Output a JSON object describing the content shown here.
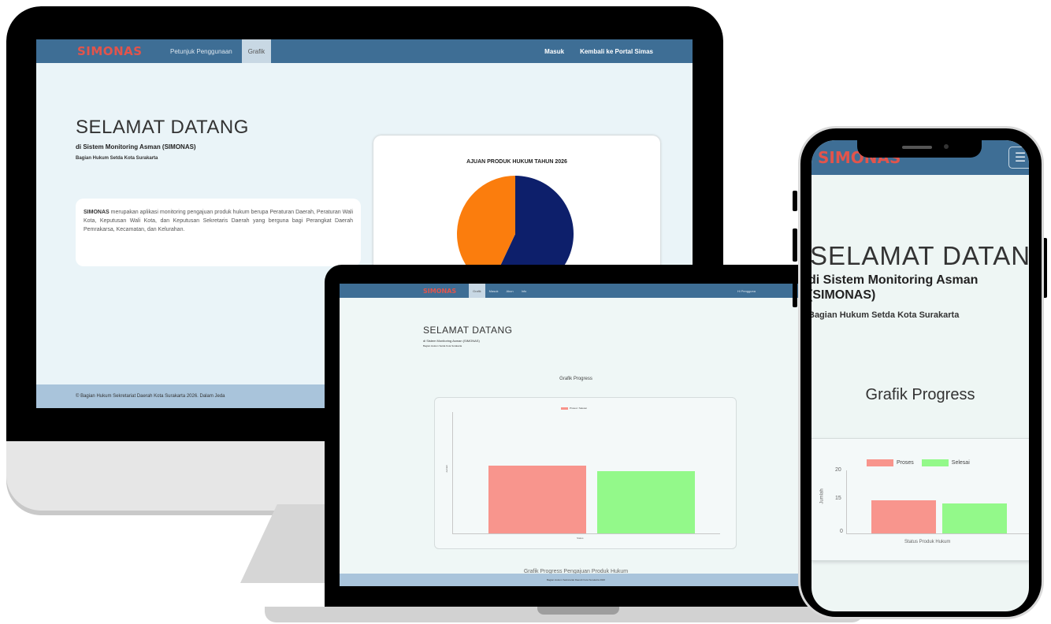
{
  "brand": {
    "logo": "SIMONAS",
    "accent": "#e3544b",
    "nav_bg": "#3e6e95",
    "footer_bg": "#a9c4db"
  },
  "desktop": {
    "nav": {
      "links": [
        "Petunjuk Penggunaan",
        "Grafik"
      ],
      "right_links": [
        "Masuk",
        "Kembali ke Portal Simas"
      ]
    },
    "hero": {
      "title": "SELAMAT DATANG",
      "subtitle": "di Sistem Monitoring Asman (SIMONAS)",
      "org": "Bagian Hukum Setda Kota Surakarta"
    },
    "description": {
      "lead": "SIMONAS",
      "text": " merupakan aplikasi monitoring pengajuan produk hukum berupa Peraturan Daerah, Peraturan Wali Kota, Keputusan Wali Kota, dan Keputusan Sekretaris Daerah yang berguna bagi Perangkat Daerah Pemrakarsa, Kecamatan, dan Kelurahan."
    },
    "chart_title": "AJUAN PRODUK HUKUM TAHUN 2026",
    "footer": "© Bagian Hukum Sekretariat Daerah Kota Surakarta 2026. Dalam Jeda"
  },
  "laptop": {
    "nav": {
      "links": [
        "Grafik",
        "Masuk",
        "Akun",
        "Info"
      ],
      "right": "Hi Pengguna"
    },
    "hero": {
      "title": "SELAMAT DATANG",
      "subtitle": "di Sistem Monitoring Asman (SIMONAS)",
      "org": "Bagian Hukum Setda Kota Surakarta"
    },
    "graf_title": "Grafik Progress",
    "legend": "Proses / Selesai",
    "y_label": "Jumlah",
    "x_label": "Status",
    "footer_title": "Grafik Progress Pengajuan Produk Hukum",
    "footer": "Bagian Hukum Sekretariat Daerah Kota Surakarta 2026"
  },
  "phone": {
    "hero": {
      "title": "SELAMAT DATANG",
      "subtitle": "di Sistem Monitoring Asman (SIMONAS)",
      "org": "Bagian Hukum Setda Kota Surakarta"
    },
    "graf_title": "Grafik Progress",
    "legend": {
      "proses": "Proses",
      "selesai": "Selesai"
    },
    "y_ticks": [
      "20",
      "15",
      "0"
    ],
    "y_label": "Jumlah",
    "x_label": "Status Produk Hukum"
  },
  "chart_data": [
    {
      "type": "pie",
      "title": "AJUAN PRODUK HUKUM TAHUN 2026",
      "categories": [
        "Selesai",
        "Proses"
      ],
      "values": [
        57,
        43
      ],
      "colors": [
        "#0d1f6b",
        "#fb7d0d"
      ]
    },
    {
      "type": "bar",
      "title": "Grafik Progress",
      "categories": [
        "Proses",
        "Selesai"
      ],
      "values": [
        12,
        11
      ],
      "colors": [
        "#f8958d",
        "#93f98a"
      ],
      "ylim": [
        0,
        20
      ]
    }
  ]
}
